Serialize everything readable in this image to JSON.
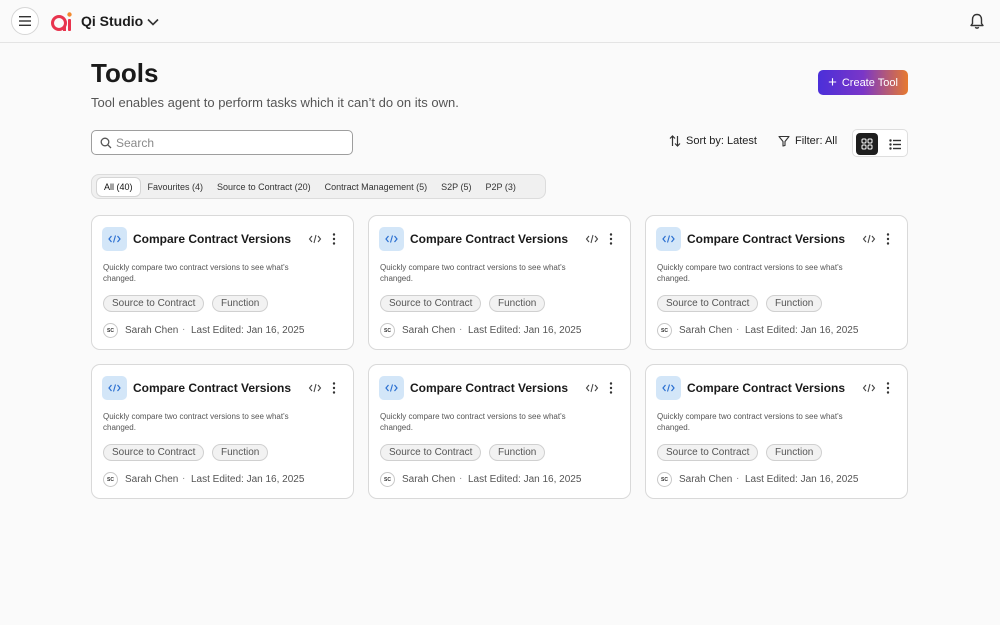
{
  "app": {
    "title": "Qi Studio",
    "brand_color": "#e8344e"
  },
  "header": {
    "title": "Tools",
    "subtitle": "Tool enables agent to perform tasks which it can’t do on its own.",
    "create_label": "Create Tool"
  },
  "toolbar": {
    "search_placeholder": "Search",
    "sort_label": "Sort by: Latest",
    "filter_label": "Filter: All"
  },
  "tabs": [
    {
      "label": "All (40)",
      "active": true
    },
    {
      "label": "Favourites (4)",
      "active": false
    },
    {
      "label": "Source to Contract (20)",
      "active": false
    },
    {
      "label": "Contract Management (5)",
      "active": false
    },
    {
      "label": "S2P (5)",
      "active": false
    },
    {
      "label": "P2P (3)",
      "active": false
    }
  ],
  "cards": [
    {
      "title": "Compare Contract Versions",
      "description": "Quickly compare two contract versions to see what's changed.",
      "tag1": "Source to Contract",
      "tag2": "Function",
      "initials": "SC",
      "author": "Sarah Chen",
      "edited": "Last Edited: Jan 16, 2025"
    },
    {
      "title": "Compare Contract Versions",
      "description": "Quickly compare two contract versions to see what's changed.",
      "tag1": "Source to Contract",
      "tag2": "Function",
      "initials": "SC",
      "author": "Sarah Chen",
      "edited": "Last Edited: Jan 16, 2025"
    },
    {
      "title": "Compare Contract Versions",
      "description": "Quickly compare two contract versions to see what's changed.",
      "tag1": "Source to Contract",
      "tag2": "Function",
      "initials": "SC",
      "author": "Sarah Chen",
      "edited": "Last Edited: Jan 16, 2025"
    },
    {
      "title": "Compare Contract Versions",
      "description": "Quickly compare two contract versions to see what's changed.",
      "tag1": "Source to Contract",
      "tag2": "Function",
      "initials": "SC",
      "author": "Sarah Chen",
      "edited": "Last Edited: Jan 16, 2025"
    },
    {
      "title": "Compare Contract Versions",
      "description": "Quickly compare two contract versions to see what's changed.",
      "tag1": "Source to Contract",
      "tag2": "Function",
      "initials": "SC",
      "author": "Sarah Chen",
      "edited": "Last Edited: Jan 16, 2025"
    },
    {
      "title": "Compare Contract Versions",
      "description": "Quickly compare two contract versions to see what's changed.",
      "tag1": "Source to Contract",
      "tag2": "Function",
      "initials": "SC",
      "author": "Sarah Chen",
      "edited": "Last Edited: Jan 16, 2025"
    }
  ]
}
